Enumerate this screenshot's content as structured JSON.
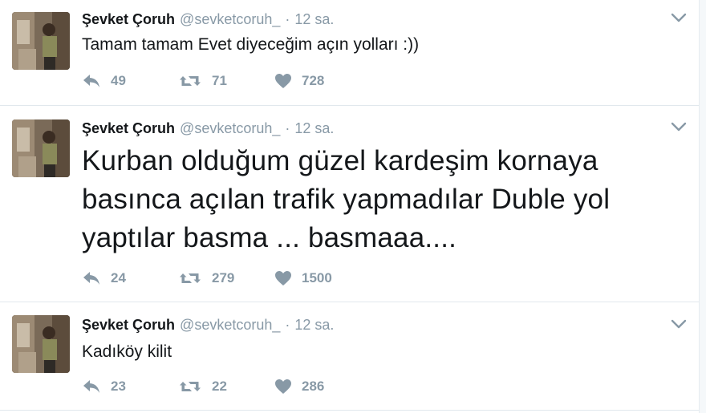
{
  "tweets": [
    {
      "name": "Şevket Çoruh",
      "handle": "@sevketcoruh_",
      "separator": "·",
      "time": "12 sa.",
      "text": "Tamam tamam Evet diyeceğim açın yolları :))",
      "replies": "49",
      "retweets": "71",
      "likes": "728"
    },
    {
      "name": "Şevket Çoruh",
      "handle": "@sevketcoruh_",
      "separator": "·",
      "time": "12 sa.",
      "text": "Kurban olduğum güzel kardeşim kornaya basınca açılan trafik yapmadılar Duble yol yaptılar basma ... basmaaa....",
      "replies": "24",
      "retweets": "279",
      "likes": "1500"
    },
    {
      "name": "Şevket Çoruh",
      "handle": "@sevketcoruh_",
      "separator": "·",
      "time": "12 sa.",
      "text": "Kadıköy kilit",
      "replies": "23",
      "retweets": "22",
      "likes": "286"
    }
  ],
  "icons": {
    "reply": "reply-icon",
    "retweet": "retweet-icon",
    "like": "heart-icon",
    "caret": "chevron-down-icon"
  },
  "colors": {
    "muted": "#8899a6",
    "text": "#14171a",
    "border": "#e1e8ed"
  }
}
